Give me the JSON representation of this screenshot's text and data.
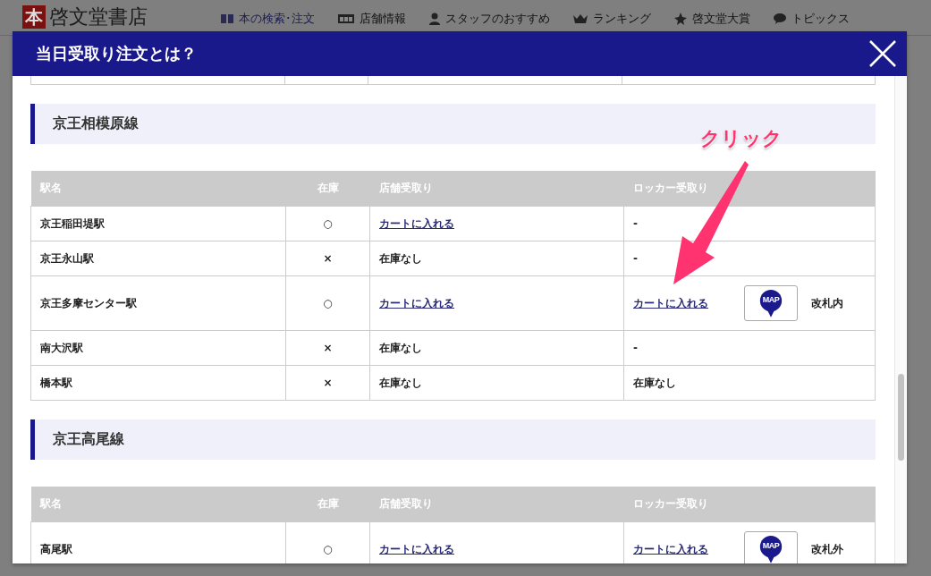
{
  "site_header": {
    "logo_mark": "本",
    "logo_text": "啓文堂書店",
    "nav": [
      {
        "label": "本の検索･注文",
        "selected": true
      },
      {
        "label": "店舗情報",
        "selected": false
      },
      {
        "label": "スタッフのおすすめ",
        "selected": false
      },
      {
        "label": "ランキング",
        "selected": false
      },
      {
        "label": "啓文堂大賞",
        "selected": false
      },
      {
        "label": "トピックス",
        "selected": false
      }
    ]
  },
  "modal": {
    "title": "当日受取り注文とは？",
    "sections": [
      {
        "title": "京王相模原線",
        "columns": [
          "駅名",
          "在庫",
          "店舗受取り",
          "ロッカー受取り"
        ],
        "rows": [
          {
            "station": "京王稲田堤駅",
            "stock": "○",
            "store": {
              "kind": "link",
              "text": "カートに入れる"
            },
            "locker": {
              "kind": "text",
              "text": "-"
            }
          },
          {
            "station": "京王永山駅",
            "stock": "×",
            "store": {
              "kind": "text",
              "text": "在庫なし"
            },
            "locker": {
              "kind": "text",
              "text": "-"
            }
          },
          {
            "station": "京王多摩センター駅",
            "stock": "○",
            "store": {
              "kind": "link",
              "text": "カートに入れる"
            },
            "locker": {
              "kind": "link",
              "text": "カートに入れる",
              "map": "MAP",
              "gate": "改札内"
            }
          },
          {
            "station": "南大沢駅",
            "stock": "×",
            "store": {
              "kind": "text",
              "text": "在庫なし"
            },
            "locker": {
              "kind": "text",
              "text": "-"
            }
          },
          {
            "station": "橋本駅",
            "stock": "×",
            "store": {
              "kind": "text",
              "text": "在庫なし"
            },
            "locker": {
              "kind": "text",
              "text": "在庫なし"
            }
          }
        ]
      },
      {
        "title": "京王高尾線",
        "columns": [
          "駅名",
          "在庫",
          "店舗受取り",
          "ロッカー受取り"
        ],
        "rows": [
          {
            "station": "高尾駅",
            "stock": "○",
            "store": {
              "kind": "link",
              "text": "カートに入れる"
            },
            "locker": {
              "kind": "link",
              "text": "カートに入れる",
              "map": "MAP",
              "gate": "改札外"
            }
          }
        ]
      }
    ]
  },
  "annotation": {
    "text": "クリック"
  }
}
